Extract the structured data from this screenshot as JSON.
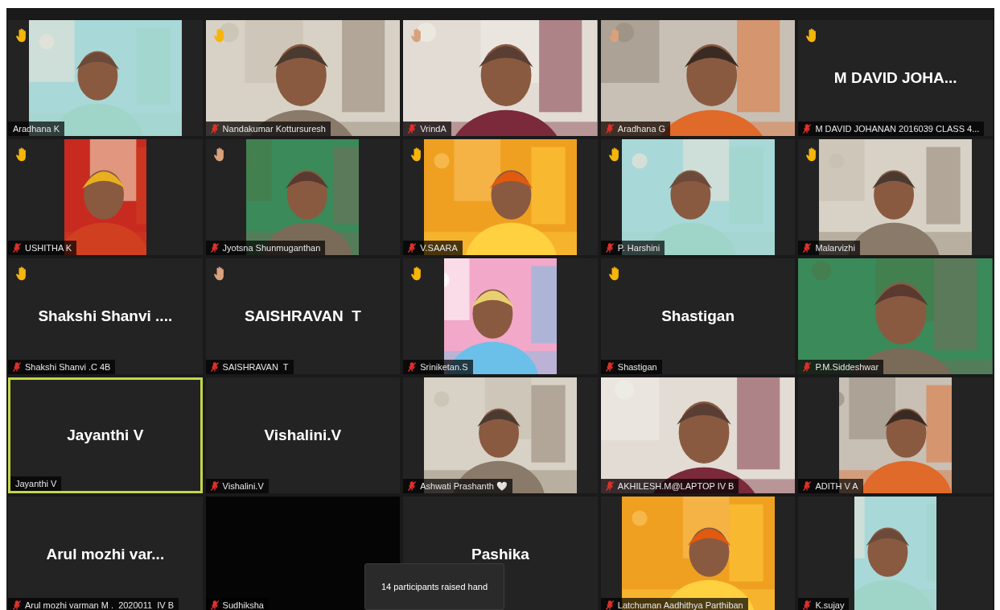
{
  "tiles": [
    {
      "kind": "standard",
      "name": "Aradhana K",
      "muted": false,
      "hand_raised": true,
      "color": "#f5b50a",
      "speaking": false
    },
    {
      "kind": "wide",
      "name": "Nandakumar Kottursuresh",
      "muted": true,
      "hand_raised": true,
      "color": "#f5b50a",
      "speaking": false
    },
    {
      "kind": "wide",
      "name": "VrindA",
      "muted": true,
      "hand_raised": true,
      "color": "#d9a27c",
      "speaking": false
    },
    {
      "kind": "wide",
      "name": "Aradhana G",
      "muted": true,
      "hand_raised": true,
      "color": "#d9a27c",
      "speaking": false
    },
    {
      "kind": "name",
      "display_name": "M DAVID JOHA...",
      "name": "M DAVID JOHANAN 2016039 CLASS 4...",
      "muted": true,
      "hand_raised": true,
      "color": "#f5b50a",
      "speaking": false
    },
    {
      "kind": "portrait",
      "name": "USHITHA K",
      "muted": true,
      "hand_raised": true,
      "color": "#f5b50a",
      "speaking": false
    },
    {
      "kind": "square",
      "name": "Jyotsna Shunmuganthan",
      "muted": true,
      "hand_raised": true,
      "color": "#d9a27c",
      "speaking": false
    },
    {
      "kind": "standard",
      "name": "V.SAARA",
      "muted": true,
      "hand_raised": true,
      "color": "#f5b50a",
      "speaking": false
    },
    {
      "kind": "standard",
      "name": "P. Harshini",
      "muted": true,
      "hand_raised": true,
      "color": "#f5b50a",
      "speaking": false
    },
    {
      "kind": "standard",
      "name": "Malarvizhi",
      "muted": true,
      "hand_raised": true,
      "color": "#f5b50a",
      "speaking": false
    },
    {
      "kind": "name",
      "display_name": "Shakshi Shanvi ....",
      "name": "Shakshi Shanvi .C 4B",
      "muted": true,
      "hand_raised": true,
      "color": "#f5b50a",
      "speaking": false
    },
    {
      "kind": "name",
      "display_name": "SAISHRAVAN  T",
      "name": "SAISHRAVAN  T",
      "muted": true,
      "hand_raised": true,
      "color": "#d9a27c",
      "speaking": false
    },
    {
      "kind": "square",
      "name": "Sriniketan.S",
      "muted": true,
      "hand_raised": true,
      "color": "#f5b50a",
      "speaking": false
    },
    {
      "kind": "name",
      "display_name": "Shastigan",
      "name": "Shastigan",
      "muted": true,
      "hand_raised": true,
      "color": "#f5b50a",
      "speaking": false
    },
    {
      "kind": "wide",
      "name": "P.M.Siddeshwar",
      "muted": true,
      "hand_raised": false,
      "speaking": false
    },
    {
      "kind": "name",
      "display_name": "Jayanthi V",
      "name": "Jayanthi V",
      "muted": false,
      "hand_raised": false,
      "speaking": true
    },
    {
      "kind": "name",
      "display_name": "Vishalini.V",
      "name": "Vishalini.V",
      "muted": true,
      "hand_raised": false,
      "speaking": false
    },
    {
      "kind": "standard",
      "name": "Ashwati Prashanth 🤍",
      "muted": true,
      "hand_raised": false,
      "speaking": false
    },
    {
      "kind": "wide",
      "name": "AKHILESH.M@LAPTOP IV B",
      "muted": true,
      "hand_raised": false,
      "speaking": false
    },
    {
      "kind": "square",
      "name": "ADITH V A",
      "muted": true,
      "hand_raised": false,
      "speaking": false
    },
    {
      "kind": "name",
      "display_name": "Arul mozhi var...",
      "name": "Arul mozhi varman M .  2020011  IV B",
      "muted": true,
      "hand_raised": false,
      "speaking": false
    },
    {
      "kind": "blank",
      "name": "Sudhiksha",
      "muted": true,
      "hand_raised": false,
      "speaking": false
    },
    {
      "kind": "name",
      "display_name": "Pashika",
      "hand_raised": false,
      "speaking": false
    },
    {
      "kind": "standard",
      "name": "Latchuman Aadhithya Parthiban",
      "muted": true,
      "hand_raised": false,
      "speaking": false
    },
    {
      "kind": "portrait",
      "name": "K.sujay",
      "muted": true,
      "hand_raised": false,
      "speaking": false
    }
  ],
  "toast": {
    "text": "14 participants raised hand"
  }
}
